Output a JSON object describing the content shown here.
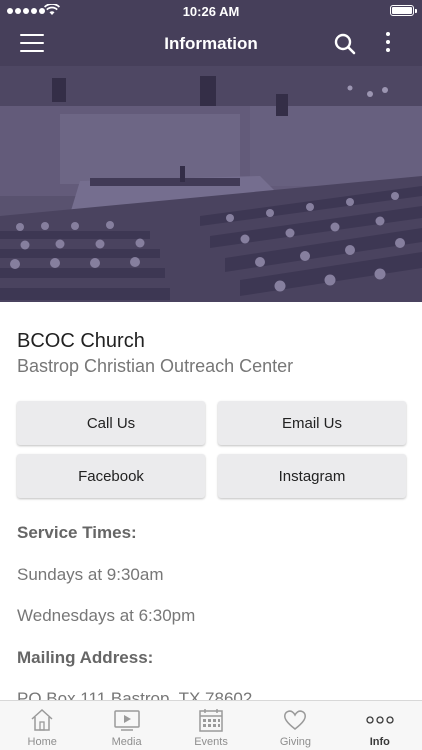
{
  "status_bar": {
    "time": "10:26 AM"
  },
  "nav": {
    "title": "Information",
    "icons": [
      "menu-icon",
      "search-icon",
      "more-vertical-icon"
    ]
  },
  "colors": {
    "brand": "#463f5a",
    "button_bg": "#ebebed",
    "text_muted": "#777777"
  },
  "church": {
    "name": "BCOC Church",
    "full_name": "Bastrop Christian Outreach Center"
  },
  "actions": {
    "call": "Call Us",
    "email": "Email Us",
    "facebook": "Facebook",
    "instagram": "Instagram"
  },
  "service_times": {
    "heading": "Service Times:",
    "items": [
      "Sundays at 9:30am",
      "Wednesdays at 6:30pm"
    ]
  },
  "mailing": {
    "heading": "Mailing Address:",
    "address": "PO Box 111 Bastrop, TX 78602"
  },
  "tabs": [
    {
      "label": "Home",
      "icon": "home-icon",
      "active": false
    },
    {
      "label": "Media",
      "icon": "media-icon",
      "active": false
    },
    {
      "label": "Events",
      "icon": "calendar-icon",
      "active": false
    },
    {
      "label": "Giving",
      "icon": "heart-icon",
      "active": false
    },
    {
      "label": "Info",
      "icon": "more-horizontal-icon",
      "active": true
    }
  ]
}
